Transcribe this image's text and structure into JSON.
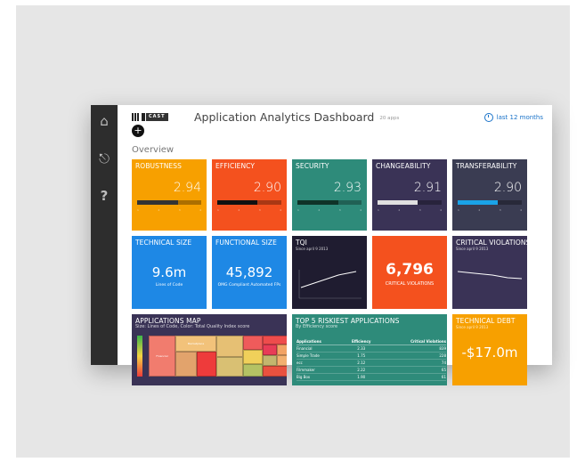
{
  "header": {
    "logo_text": "CAST",
    "title": "Application Analytics Dashboard",
    "app_count": "20 apps",
    "period": "last 12 months"
  },
  "section_title": "Overview",
  "sidebar": {
    "items": [
      {
        "icon": "home-icon",
        "glyph": "⌂"
      },
      {
        "icon": "sign-out-icon",
        "glyph": "⎋"
      },
      {
        "icon": "help-icon",
        "glyph": "?"
      }
    ]
  },
  "health": [
    {
      "key": "robustness",
      "title": "ROBUSTNESS",
      "score": "2.94",
      "color": "#f7a000",
      "bar_color": "#333333",
      "bar_fill": 0.64
    },
    {
      "key": "efficiency",
      "title": "EFFICIENCY",
      "score": "2.90",
      "color": "#f4511e",
      "bar_color": "#111111",
      "bar_fill": 0.63
    },
    {
      "key": "security",
      "title": "SECURITY",
      "score": "2.93",
      "color": "#2e8b7a",
      "bar_color": "#0f3328",
      "bar_fill": 0.64
    },
    {
      "key": "changeability",
      "title": "CHANGEABILITY",
      "score": "2.91",
      "color": "#3a3356",
      "bar_color": "#e0e0e0",
      "bar_fill": 0.63
    },
    {
      "key": "transferability",
      "title": "TRANSFERABILITY",
      "score": "2.90",
      "color": "#3a3c52",
      "bar_color": "#1aa3e8",
      "bar_fill": 0.63
    }
  ],
  "bar_ticks": [
    "1",
    "2",
    "3",
    "4"
  ],
  "technical_size": {
    "title": "TECHNICAL SIZE",
    "value": "9.6m",
    "label": "Lines of Code",
    "color": "#1e88e5"
  },
  "functional_size": {
    "title": "FUNCTIONAL SIZE",
    "value": "45,892",
    "label": "OMG Compliant Automated FPs",
    "color": "#1e88e5"
  },
  "tqi": {
    "title": "TQI",
    "subtitle": "Since april 9 2013",
    "color": "#1f1c30"
  },
  "critical_total": {
    "value": "6,796",
    "label": "CRITICAL VIOLATIONS",
    "color": "#f4511e"
  },
  "critical_trend": {
    "title": "CRITICAL VIOLATIONS",
    "subtitle": "Since april 9 2013",
    "color": "#3a3356"
  },
  "apps_map": {
    "title": "APPLICATIONS MAP",
    "subtitle": "Size: Lines of Code, Color: Total Quality Index score",
    "color": "#3a3356",
    "cells": [
      {
        "label": "Financial",
        "bg": "#f17c6e"
      },
      {
        "label": "Marketplace",
        "bg": "#f2c27a"
      },
      {
        "label": "",
        "bg": "#e2a36c"
      },
      {
        "label": "",
        "bg": "#ee3b3b"
      },
      {
        "label": "",
        "bg": "#e6c074"
      },
      {
        "label": "",
        "bg": "#d9c073"
      },
      {
        "label": "",
        "bg": "#ef5b5b"
      },
      {
        "label": "",
        "bg": "#f0d05a"
      },
      {
        "label": "",
        "bg": "#b4c264"
      },
      {
        "label": "",
        "bg": "#ee4c4c"
      },
      {
        "label": "",
        "bg": "#e83c57"
      },
      {
        "label": "",
        "bg": "#f2a365"
      },
      {
        "label": "",
        "bg": "#c3b66e"
      },
      {
        "label": "",
        "bg": "#f2b070"
      },
      {
        "label": "",
        "bg": "#e9513f"
      }
    ]
  },
  "riskiest": {
    "title": "TOP 5 RISKIEST APPLICATIONS",
    "subtitle": "By Efficiency score",
    "color": "#2e8b7a",
    "columns": [
      "Applications",
      "Efficiency",
      "Critical Violations"
    ],
    "rows": [
      [
        "Financial",
        "2.33",
        "839"
      ],
      [
        "Simple Trade",
        "1.75",
        "228"
      ],
      [
        "ecc",
        "2.12",
        "74"
      ],
      [
        "Filmmaker",
        "2.22",
        "65"
      ],
      [
        "Big Box",
        "1.90",
        "61"
      ]
    ]
  },
  "technical_debt": {
    "title": "TECHNICAL DEBT",
    "subtitle": "Since april 9 2013",
    "value": "-$17.0m",
    "color": "#f7a000"
  }
}
